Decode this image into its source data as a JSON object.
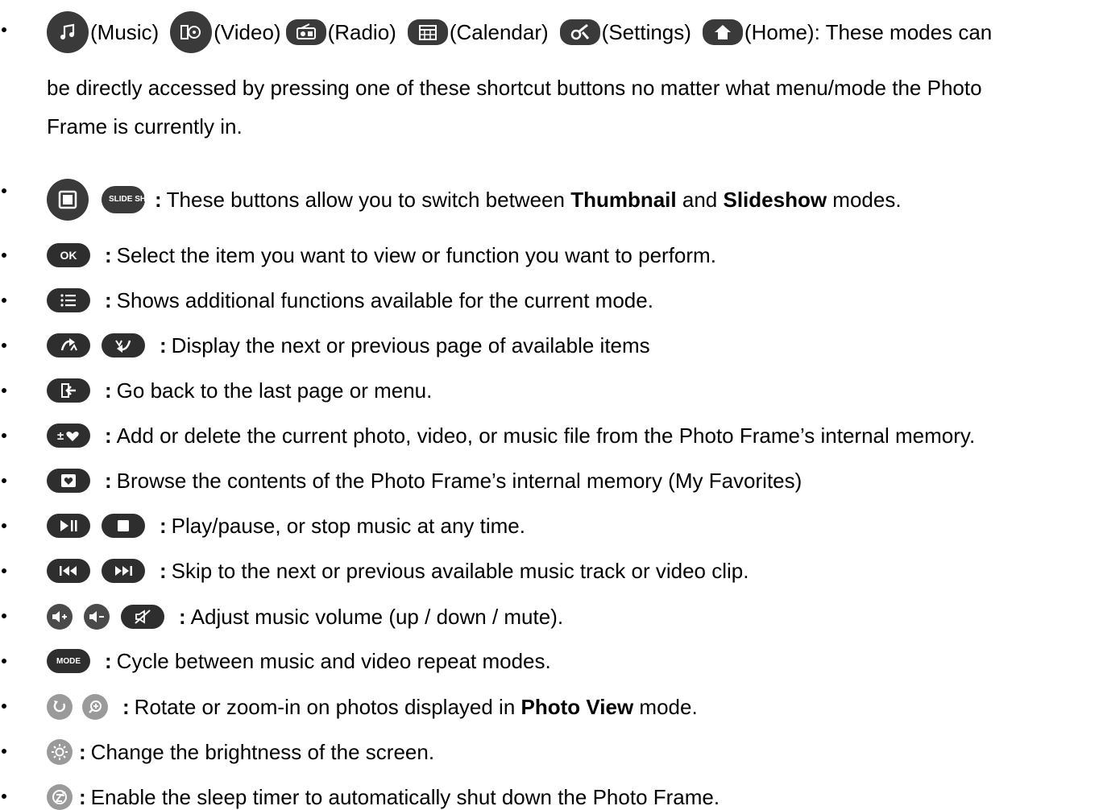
{
  "items": [
    {
      "line1": {
        "labels": [
          "(Music)",
          "(Video)",
          "(Radio)",
          "(Calendar)",
          "(Settings)",
          "(Home)"
        ],
        "tail": ": These modes can"
      },
      "line2": "be directly accessed by pressing one of these shortcut buttons no matter what menu/mode the Photo",
      "line3": "Frame is currently in.",
      "icons": [
        "music-icon",
        "video-icon",
        "radio-icon",
        "calendar-icon",
        "settings-icon",
        "home-icon"
      ]
    },
    {
      "icons": [
        "thumbnail-icon",
        "slideshow-icon"
      ],
      "slideshow_button_text": "SLIDE SHOW",
      "sep": ":",
      "text_pre": "These buttons allow you to switch between",
      "bold1": "Thumbnail",
      "text_mid": "and",
      "bold2": "Slideshow",
      "text_post": "modes."
    },
    {
      "icons": [
        "ok-icon"
      ],
      "button_text": "OK",
      "sep": ":",
      "text": "Select the item you want to view or function you want to perform."
    },
    {
      "icons": [
        "menu-icon"
      ],
      "sep": ":",
      "text": "Shows additional functions available for the current mode."
    },
    {
      "icons": [
        "page-up-icon",
        "page-down-icon"
      ],
      "sep": ":",
      "text": "Display the next or previous page of available items"
    },
    {
      "icons": [
        "back-icon"
      ],
      "sep": ":",
      "text": "Go back to the last page or menu."
    },
    {
      "icons": [
        "add-delete-favorite-icon"
      ],
      "sep": ":",
      "text": "Add or delete the current photo, video, or music file from the Photo Frame’s internal memory."
    },
    {
      "icons": [
        "favorites-icon"
      ],
      "sep": ":",
      "text": "Browse the contents of the Photo Frame’s internal memory (My Favorites)"
    },
    {
      "icons": [
        "play-pause-icon",
        "stop-icon"
      ],
      "sep": ":",
      "text": "Play/pause, or stop music at any time."
    },
    {
      "icons": [
        "previous-track-icon",
        "next-track-icon"
      ],
      "sep": ":",
      "text": "Skip to the next or previous available music track or video clip."
    },
    {
      "icons": [
        "volume-up-icon",
        "volume-down-icon",
        "mute-icon"
      ],
      "sep": ":",
      "text": "Adjust music volume (up / down / mute)."
    },
    {
      "icons": [
        "mode-icon"
      ],
      "button_text": "MODE",
      "sep": ":",
      "text": "Cycle between music and video repeat modes."
    },
    {
      "icons": [
        "rotate-icon",
        "zoom-in-icon"
      ],
      "sep": ":",
      "text_pre": "Rotate or zoom-in on photos displayed in",
      "bold": "Photo View",
      "text_post": "mode."
    },
    {
      "icons": [
        "brightness-icon"
      ],
      "sep": ":",
      "text": "Change the brightness of the screen."
    },
    {
      "icons": [
        "sleep-timer-icon"
      ],
      "sep": ":",
      "text": "Enable the sleep timer to automatically shut down the Photo Frame."
    }
  ]
}
